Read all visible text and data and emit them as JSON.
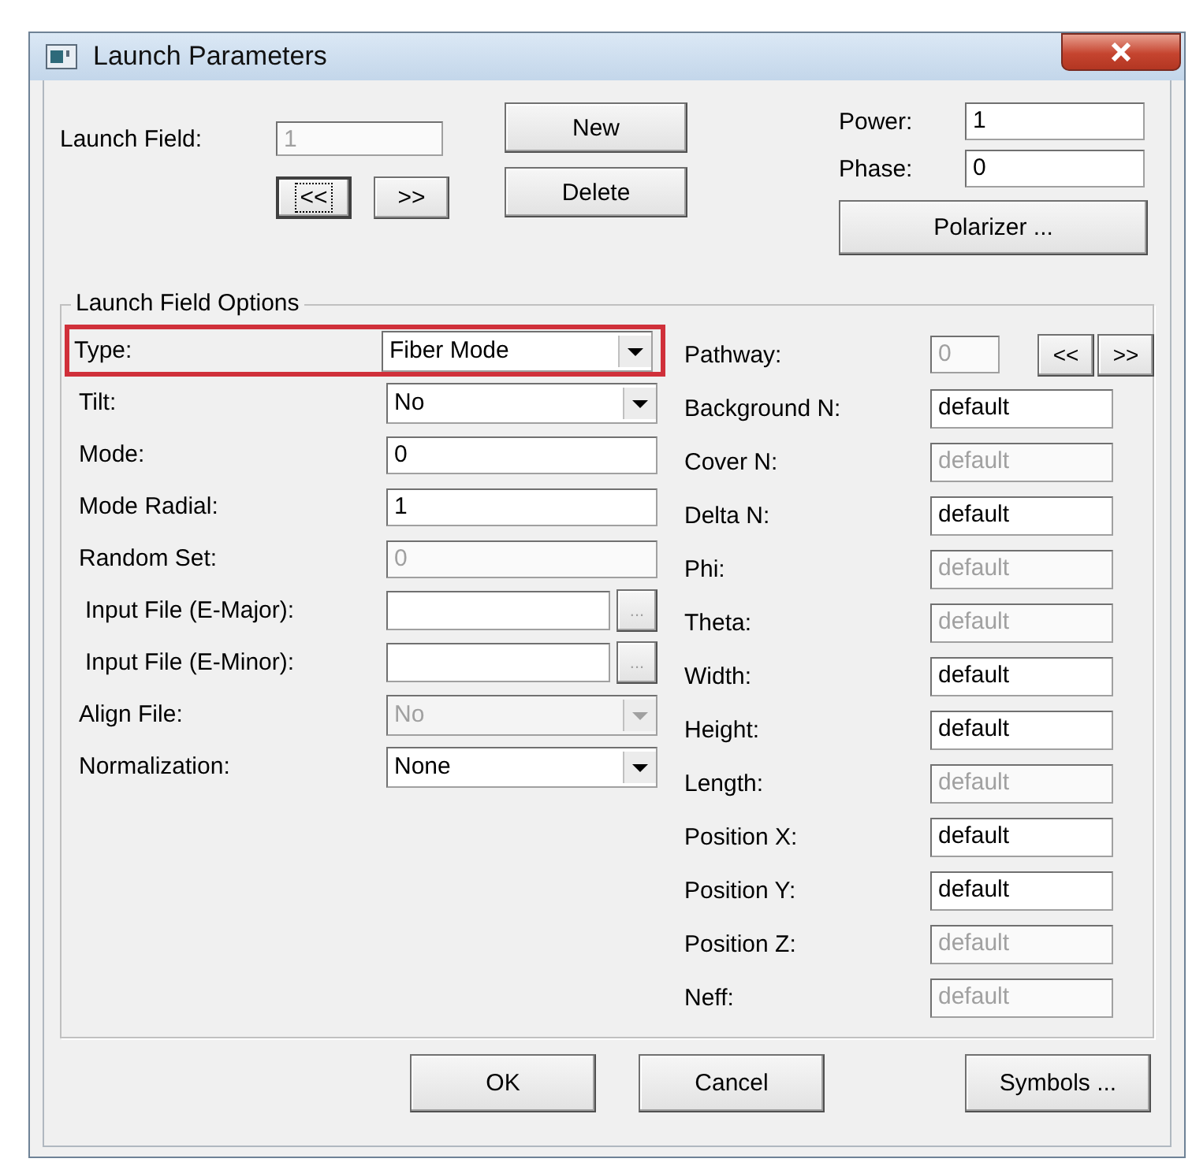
{
  "window": {
    "title": "Launch Parameters"
  },
  "launch_field": {
    "label": "Launch Field:",
    "value": "1",
    "disabled": true
  },
  "nav_buttons": [
    {
      "label": "<<",
      "focused": true
    },
    {
      "label": ">>",
      "focused": false
    }
  ],
  "new_button": "New",
  "delete_button": "Delete",
  "power": {
    "label": "Power:",
    "value": "1"
  },
  "phase": {
    "label": "Phase:",
    "value": "0"
  },
  "polarizer_button": "Polarizer ...",
  "options": {
    "title": "Launch Field Options",
    "left_rows": [
      {
        "kind": "dropdown",
        "label": "Type:",
        "value": "Fiber Mode",
        "disabled": false,
        "highlighted": true
      },
      {
        "kind": "dropdown",
        "label": "Tilt:",
        "value": "No",
        "disabled": false,
        "highlighted": false
      },
      {
        "kind": "text",
        "label": "Mode:",
        "value": "0",
        "disabled": false,
        "highlighted": false
      },
      {
        "kind": "text",
        "label": "Mode Radial:",
        "value": "1",
        "disabled": false,
        "highlighted": false
      },
      {
        "kind": "text",
        "label": "Random Set:",
        "value": "0",
        "disabled": true,
        "highlighted": false
      },
      {
        "kind": "file",
        "label": "Input File (E-Major):",
        "browse": "...",
        "browse_disabled": true,
        "highlighted": false
      },
      {
        "kind": "file",
        "label": "Input File (E-Minor):",
        "browse": "...",
        "browse_disabled": true,
        "highlighted": false
      },
      {
        "kind": "dropdown",
        "label": "Align File:",
        "value": "No",
        "disabled": true,
        "highlighted": false
      },
      {
        "kind": "dropdown",
        "label": "Normalization:",
        "value": "None",
        "disabled": false,
        "highlighted": false
      }
    ],
    "right_rows": [
      {
        "kind": "pathway",
        "label": "Pathway:",
        "value": "0",
        "disabled": true,
        "buttons": [
          "<<",
          ">>"
        ]
      },
      {
        "kind": "text",
        "label": "Background N:",
        "value": "default",
        "disabled": false
      },
      {
        "kind": "text",
        "label": "Cover N:",
        "value": "default",
        "disabled": true
      },
      {
        "kind": "text",
        "label": "Delta N:",
        "value": "default",
        "disabled": false
      },
      {
        "kind": "text",
        "label": "Phi:",
        "value": "default",
        "disabled": true
      },
      {
        "kind": "text",
        "label": "Theta:",
        "value": "default",
        "disabled": true
      },
      {
        "kind": "text",
        "label": "Width:",
        "value": "default",
        "disabled": false
      },
      {
        "kind": "text",
        "label": "Height:",
        "value": "default",
        "disabled": false
      },
      {
        "kind": "text",
        "label": "Length:",
        "value": "default",
        "disabled": true
      },
      {
        "kind": "text",
        "label": "Position X:",
        "value": "default",
        "disabled": false
      },
      {
        "kind": "text",
        "label": "Position Y:",
        "value": "default",
        "disabled": false
      },
      {
        "kind": "text",
        "label": "Position Z:",
        "value": "default",
        "disabled": true
      },
      {
        "kind": "text",
        "label": "Neff:",
        "value": "default",
        "disabled": true
      }
    ]
  },
  "footer_buttons": [
    "OK",
    "Cancel",
    "Symbols ..."
  ]
}
